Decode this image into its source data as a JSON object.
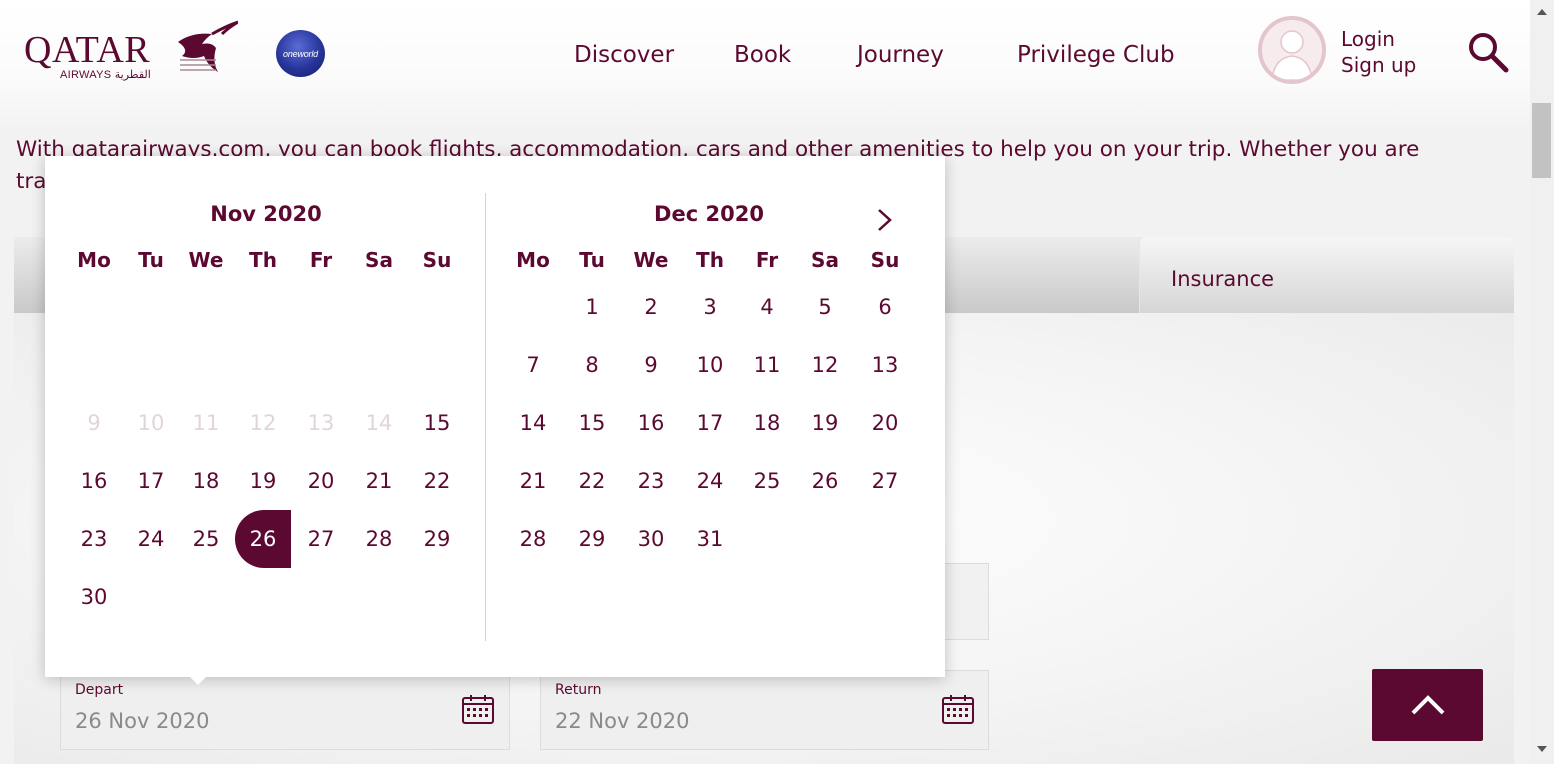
{
  "header": {
    "logo": {
      "brand": "QATAR",
      "sub": "AIRWAYS",
      "arabic": "القطرية"
    },
    "alliance_badge": "oneworld",
    "nav": [
      {
        "label": "Discover"
      },
      {
        "label": "Book"
      },
      {
        "label": "Journey"
      },
      {
        "label": "Privilege Club"
      }
    ],
    "login_label": "Login",
    "signup_label": "Sign up"
  },
  "intro_text": "With qatarairways.com, you can book flights, accommodation, cars and other amenities to help you on your trip. Whether you are",
  "intro_text_2": "tra",
  "tabs": {
    "insurance_label": "Insurance"
  },
  "fields": {
    "depart": {
      "label": "Depart",
      "value": "26 Nov 2020"
    },
    "return": {
      "label": "Return",
      "value": "22 Nov 2020"
    }
  },
  "colors": {
    "brand": "#5c0931",
    "disabled": "#e0d6d9"
  },
  "datepicker": {
    "weekdays": [
      "Mo",
      "Tu",
      "We",
      "Th",
      "Fr",
      "Sa",
      "Su"
    ],
    "months": [
      {
        "title": "Nov 2020",
        "leading_blank": 6,
        "days": 30,
        "disabled_before": 15,
        "hidden_before": 9,
        "selected": 26
      },
      {
        "title": "Dec 2020",
        "leading_blank": 1,
        "days": 31,
        "disabled_before": 0,
        "hidden_before": 0,
        "selected": null
      }
    ],
    "next_icon": "chevron-right-icon"
  }
}
